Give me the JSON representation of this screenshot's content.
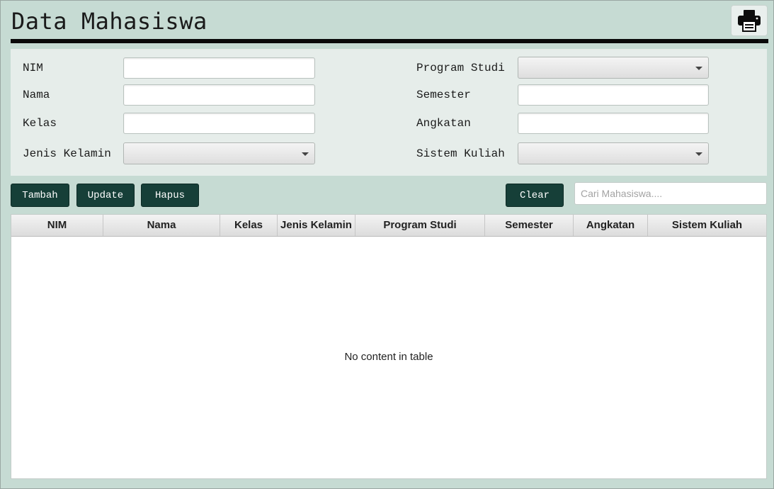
{
  "header": {
    "title": "Data Mahasiswa",
    "print_icon": "printer-icon"
  },
  "form": {
    "nim_label": "NIM",
    "nama_label": "Nama",
    "kelas_label": "Kelas",
    "jenis_kelamin_label": "Jenis Kelamin",
    "program_studi_label": "Program Studi",
    "semester_label": "Semester",
    "angkatan_label": "Angkatan",
    "sistem_kuliah_label": "Sistem Kuliah",
    "nim_value": "",
    "nama_value": "",
    "kelas_value": "",
    "semester_value": "",
    "angkatan_value": "",
    "jenis_kelamin_selected": "",
    "program_studi_selected": "",
    "sistem_kuliah_selected": ""
  },
  "actions": {
    "tambah": "Tambah",
    "update": "Update",
    "hapus": "Hapus",
    "clear": "Clear"
  },
  "search": {
    "placeholder": "Cari Mahasiswa....",
    "value": ""
  },
  "table": {
    "columns": [
      "NIM",
      "Nama",
      "Kelas",
      "Jenis Kelamin",
      "Program Studi",
      "Semester",
      "Angkatan",
      "Sistem Kuliah"
    ],
    "rows": [],
    "empty_text": "No content in table"
  },
  "colors": {
    "background": "#c6dbd3",
    "panel": "#e6edea",
    "button": "#163f38"
  }
}
